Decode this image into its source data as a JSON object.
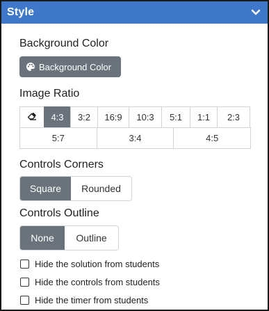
{
  "header": {
    "title": "Style",
    "collapse_icon": "chevron-down-icon"
  },
  "background": {
    "label": "Background Color",
    "button_label": "Background Color",
    "button_icon": "palette-icon"
  },
  "ratio": {
    "label": "Image Ratio",
    "eraser_icon": "eraser-icon",
    "row1": [
      "4:3",
      "3:2",
      "16:9",
      "10:3",
      "5:1",
      "1:1",
      "2:3"
    ],
    "row2": [
      "5:7",
      "3:4",
      "4:5"
    ],
    "selected": "4:3"
  },
  "corners": {
    "label": "Controls Corners",
    "options": [
      "Square",
      "Rounded"
    ],
    "selected": "Square"
  },
  "outline": {
    "label": "Controls Outline",
    "options": [
      "None",
      "Outline"
    ],
    "selected": "None"
  },
  "checkboxes": [
    {
      "label": "Hide the solution from students",
      "checked": false
    },
    {
      "label": "Hide the controls from students",
      "checked": false
    },
    {
      "label": "Hide the timer from students",
      "checked": false
    }
  ],
  "colors": {
    "header": "#3f78c9",
    "active": "#6a737b",
    "border": "#cfd4d8"
  }
}
